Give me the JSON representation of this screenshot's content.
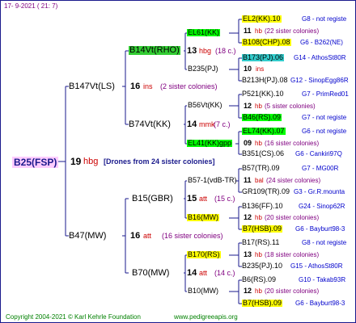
{
  "header": {
    "date": "17-  9-2021 (  21:  7)"
  },
  "footer": {
    "copyright": "Copyright 2004-2021 © Karl Kehrle Foundation",
    "site": "www.pedigreeapis.org"
  },
  "colors": {
    "queen_bg": "#ffccff",
    "lime": "#00ff00",
    "green": "#33cc33",
    "yellow": "#ffff00",
    "cyan": "#33cccc",
    "red": "#cc0000",
    "pink": "#ff00ff",
    "blue": "#0000cc",
    "purple": "#800080",
    "navy": "#1a1a8c"
  },
  "queen": {
    "name": "B25(FSP)",
    "num": "19",
    "wa": "hbg",
    "drones": "[Drones from 24 sister colonies]"
  },
  "gen1": {
    "top": {
      "name": "B147Vt(LS)",
      "num": "16",
      "wa": "ins",
      "note": "(2 sister colonies)"
    },
    "bottom": {
      "name": "B47(MW)",
      "num": "16",
      "wa": "att",
      "note": "(16 sister colonies)"
    }
  },
  "gen2": {
    "a": {
      "name": "B14Vt(RHO)",
      "num": "13",
      "wa": "hbg",
      "gs": "(18 c.)"
    },
    "b": {
      "name": "B74Vt(KK)",
      "num": "14",
      "wa": "mmk",
      "gs": "(7 c.)"
    },
    "c": {
      "name": "B15(GBR)",
      "num": "15",
      "wa": "att",
      "gs": "(15 c.)"
    },
    "d": {
      "name": "B70(MW)",
      "num": "14",
      "wa": "att",
      "gs": "(14 c.)"
    }
  },
  "gen3": {
    "a1": {
      "name": "EL61(KK)"
    },
    "a2": {
      "name": "B235(PJ)"
    },
    "b1": {
      "name": "B56Vt(KK)"
    },
    "b2": {
      "name": "EL41(KK)gpp"
    },
    "c1": {
      "name": "B57-1(vdB-TR)"
    },
    "c2": {
      "name": "B16(MW)"
    },
    "d1": {
      "name": "B170(RS)"
    },
    "d2": {
      "name": "B10(MW)"
    }
  },
  "gen4": [
    {
      "name": "EL2(KK).10",
      "link": "G8 - not registe",
      "num": "11",
      "wa": "hb",
      "note": "(22 sister colonies)"
    },
    {
      "name": "B108(CHP).08",
      "link": "G6 - B262(NE)",
      "num": "10",
      "wa": "ins"
    },
    {
      "name": "B173(PJ).06",
      "link": "G14 - AthosSt80R",
      "num": "",
      "wa": ""
    },
    {
      "name": "B213H(PJ).08",
      "link": "G12 - SinopEgg86R",
      "num": "",
      "wa": ""
    },
    {
      "name": "P521(KK).10",
      "link": "G7 - PrimRed01",
      "num": "12",
      "wa": "hb",
      "note": "(5 sister colonies)"
    },
    {
      "name": "B46(RS).09",
      "link": "G7 - not registe",
      "num": "",
      "wa": ""
    },
    {
      "name": "EL74(KK).07",
      "link": "G6 - not registe",
      "num": "09",
      "wa": "hb",
      "note": "(16 sister colonies)"
    },
    {
      "name": "B351(CS).06",
      "link": "G6 - Cankiri97Q",
      "num": "",
      "wa": ""
    },
    {
      "name": "B57(TR).09",
      "link": "G7 - MG00R",
      "num": "11",
      "wa": "bal",
      "note": "(24 sister colonies)"
    },
    {
      "name": "GR109(TR).09",
      "link": "G3 - Gr.R.mounta",
      "num": "",
      "wa": ""
    },
    {
      "name": "B136(FF).10",
      "link": "G24 - Sinop62R",
      "num": "12",
      "wa": "hb",
      "note": "(20 sister colonies)"
    },
    {
      "name": "B7(HSB).09",
      "link": "G6 - Bayburt98-3",
      "num": "",
      "wa": ""
    },
    {
      "name": "B17(RS).11",
      "link": "G8 - not registe",
      "num": "13",
      "wa": "hb",
      "note": "(18 sister colonies)"
    },
    {
      "name": "B235(PJ).10",
      "link": "G15 - AthosSt80R",
      "num": "",
      "wa": ""
    },
    {
      "name": "B6(RS).09",
      "link": "G10 - Takab93R",
      "num": "12",
      "wa": "hb",
      "note": "(20 sister colonies)"
    },
    {
      "name": "B7(HSB).09",
      "link": "G6 - Bayburt98-3",
      "num": "",
      "wa": ""
    }
  ]
}
